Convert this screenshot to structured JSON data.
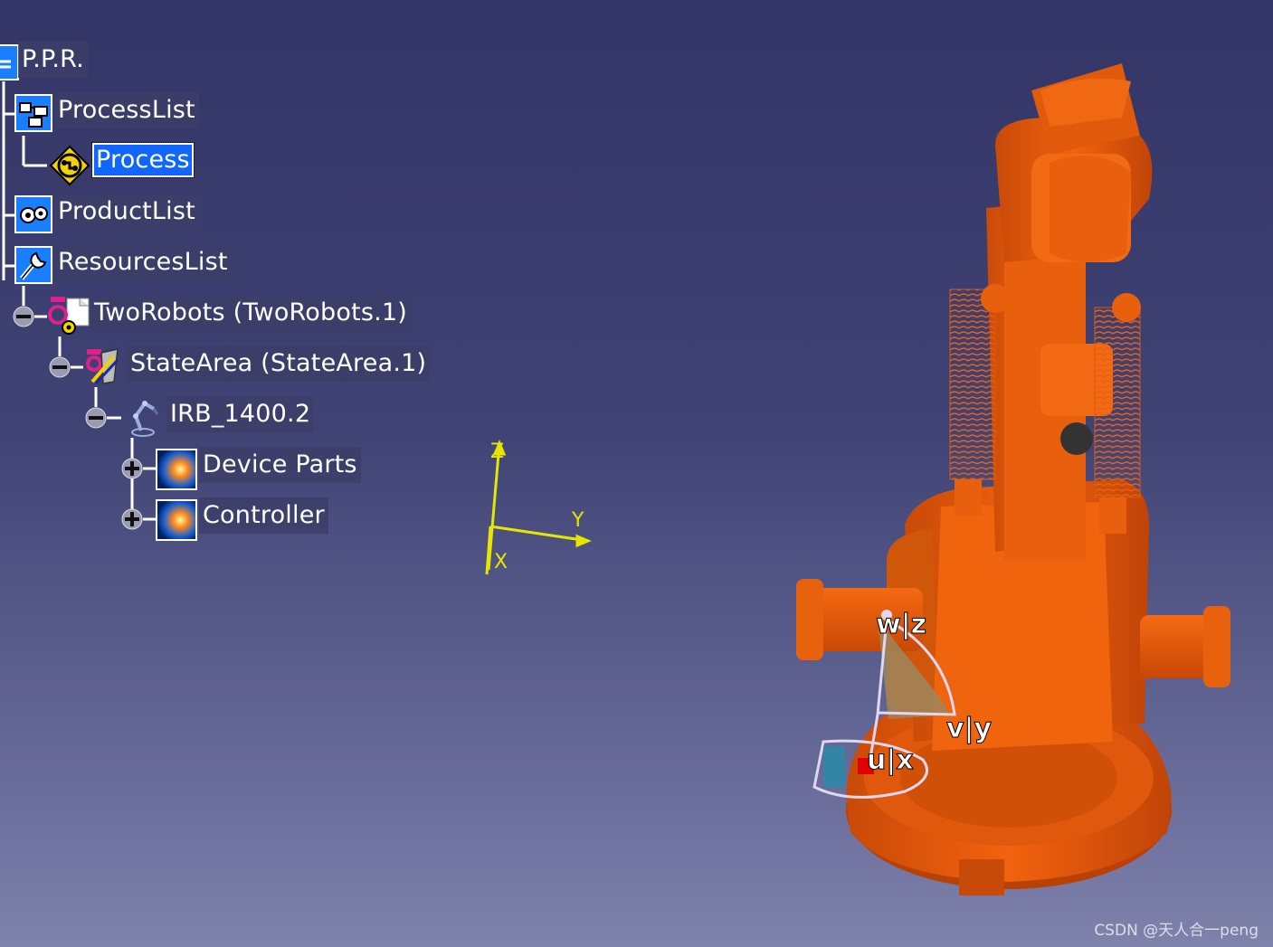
{
  "tree": {
    "root": "P.P.R.",
    "process_list": "ProcessList",
    "process": "Process",
    "product_list": "ProductList",
    "resources_list": "ResourcesList",
    "two_robots": "TwoRobots (TwoRobots.1)",
    "state_area": "StateArea (StateArea.1)",
    "robot": "IRB_1400.2",
    "device_parts": "Device Parts",
    "controller": "Controller"
  },
  "compass": {
    "z_label": "Z",
    "y_label": "Y",
    "x_label": "X",
    "color": "#e6e600"
  },
  "manipulator": {
    "w_label": "w|z",
    "v_label": "v|y",
    "u_label": "u|x"
  },
  "robot_model": {
    "color": "#e85a10"
  },
  "watermark": "CSDN @天人合一peng"
}
